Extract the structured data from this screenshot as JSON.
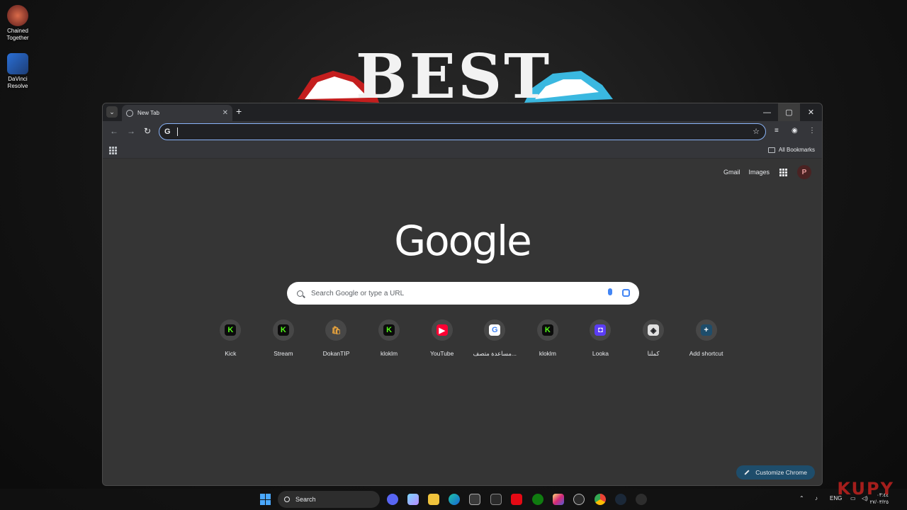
{
  "desktop": {
    "icons": [
      {
        "label": "Chained\nTogether",
        "icon": "chained-together-icon"
      },
      {
        "label": "DaVinci\nResolve",
        "icon": "davinci-resolve-icon"
      }
    ],
    "wallpaper_text": "BEST",
    "watermark": "KUPY"
  },
  "browser": {
    "tab_title": "New Tab",
    "omnibox_value": "",
    "bookmarks_all_label": "All Bookmarks",
    "window_controls": [
      "minimize",
      "maximize",
      "close"
    ]
  },
  "ntp": {
    "top_links": {
      "gmail": "Gmail",
      "images": "Images",
      "avatar_letter": "P"
    },
    "logo_text": "Google",
    "search_placeholder": "Search Google or type a URL",
    "shortcuts": [
      {
        "name": "Kick",
        "glyph": "K",
        "color": "#53fc18",
        "bg": "#0b0b0b"
      },
      {
        "name": "Stream",
        "glyph": "K",
        "color": "#53fc18",
        "bg": "#0b0b0b"
      },
      {
        "name": "DokanTIP",
        "glyph": "🛍",
        "color": "#e8a33d",
        "bg": "#474747"
      },
      {
        "name": "kloklm",
        "glyph": "K",
        "color": "#53fc18",
        "bg": "#0b0b0b"
      },
      {
        "name": "YouTube",
        "glyph": "▶",
        "color": "#ffffff",
        "bg": "#ff0033"
      },
      {
        "name": "مساعدة متصف...",
        "glyph": "G",
        "color": "#4285f4",
        "bg": "#ffffff"
      },
      {
        "name": "kloklm",
        "glyph": "K",
        "color": "#53fc18",
        "bg": "#0b0b0b"
      },
      {
        "name": "Looka",
        "glyph": "◘",
        "color": "#ffffff",
        "bg": "#5b3df5"
      },
      {
        "name": "كملنا",
        "glyph": "◈",
        "color": "#202124",
        "bg": "#e0e0e0"
      },
      {
        "name": "Add shortcut",
        "glyph": "+",
        "color": "#ffffff",
        "bg": "#1e4d6b"
      }
    ],
    "customize_label": "Customize Chrome"
  },
  "taskbar": {
    "search_label": "Search",
    "language": "ENG",
    "clock_time": "٠٣:٤٤",
    "clock_date": "٢٧/٠٣/٢٥"
  },
  "colors": {
    "accent": "#8ab4f8",
    "ntp_bg": "#353535",
    "kick_green": "#53fc18"
  }
}
